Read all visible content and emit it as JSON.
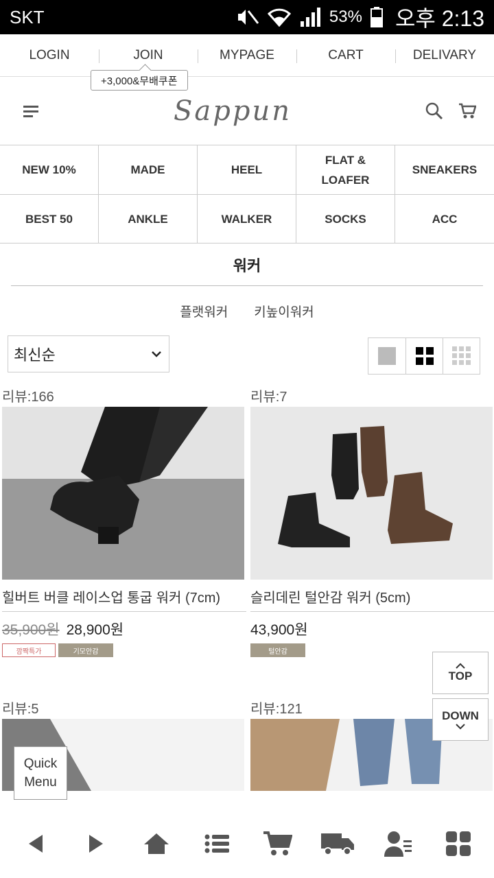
{
  "status": {
    "carrier": "SKT",
    "battery": "53%",
    "time": "오후 2:13"
  },
  "topnav": [
    "LOGIN",
    "JOIN",
    "MYPAGE",
    "CART",
    "DELIVARY"
  ],
  "coupon": "+3,000&무배쿠폰",
  "logo": "Sappun",
  "categories": [
    "NEW 10%",
    "MADE",
    "HEEL",
    "FLAT &\nLOAFER",
    "SNEAKERS",
    "BEST 50",
    "ANKLE",
    "WALKER",
    "SOCKS",
    "ACC"
  ],
  "page_title": "워커",
  "subcategories": [
    "플랫워커",
    "키높이워커"
  ],
  "sort": {
    "selected": "최신순"
  },
  "products": [
    {
      "review": "리뷰:166",
      "name": "힐버트 버클 레이스업 통굽 워커 (7cm)",
      "old_price": "35,900원",
      "price": "28,900원",
      "badges": [
        "깜짝특가",
        "기모안감"
      ]
    },
    {
      "review": "리뷰:7",
      "name": "슬리데린 털안감 워커 (5cm)",
      "old_price": "",
      "price": "43,900원",
      "badges": [
        "털안감"
      ]
    },
    {
      "review": "리뷰:5"
    },
    {
      "review": "리뷰:121"
    }
  ],
  "float": {
    "top": "TOP",
    "down": "DOWN"
  },
  "quick_menu": "Quick\nMenu"
}
